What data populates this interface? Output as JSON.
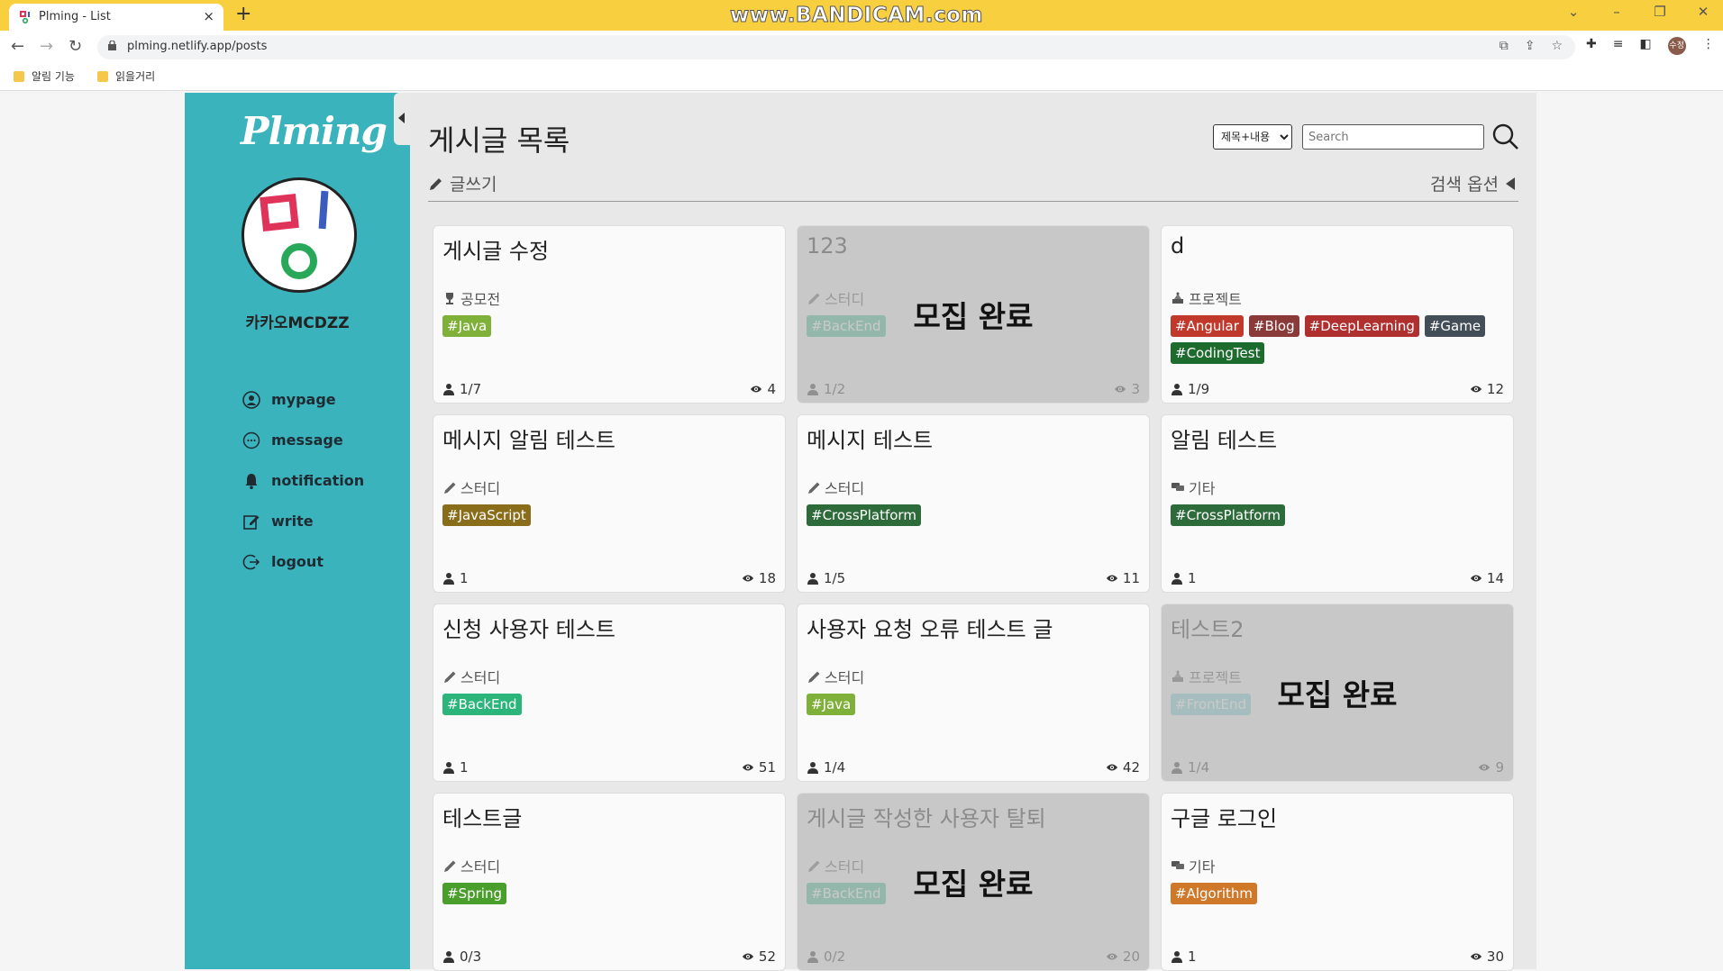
{
  "browser": {
    "tab_title": "Plming - List",
    "tab_close": "×",
    "new_tab": "+",
    "watermark": "www.BANDICAM.com",
    "url": "plming.netlify.app/posts",
    "profile_initials": "수정",
    "bookmarks": [
      "알림 기능",
      "읽을거리"
    ]
  },
  "sidebar": {
    "logo": "Plming",
    "username": "카카오MCDZZ",
    "menu": [
      {
        "label": "mypage",
        "icon": "user-circle-icon"
      },
      {
        "label": "message",
        "icon": "message-icon"
      },
      {
        "label": "notification",
        "icon": "bell-icon"
      },
      {
        "label": "write",
        "icon": "edit-icon"
      },
      {
        "label": "logout",
        "icon": "logout-icon"
      }
    ]
  },
  "main": {
    "title": "게시글 목록",
    "search_select": "제목+내용",
    "search_placeholder": "Search",
    "write_label": "글쓰기",
    "search_options_label": "검색 옵션"
  },
  "colors": {
    "sidebar": "#3bb3bd",
    "browser_bar": "#f7cf3f"
  },
  "posts": [
    {
      "title": "게시글 수정",
      "category": "공모전",
      "category_icon": "trophy-icon",
      "tags": [
        {
          "text": "#Java",
          "color": "#7fb03a"
        }
      ],
      "members": "1/7",
      "views": "4",
      "done": false
    },
    {
      "title": "123",
      "category": "스터디",
      "category_icon": "pencil-icon",
      "tags": [
        {
          "text": "#BackEnd",
          "color": "#3fbf8f"
        }
      ],
      "members": "1/2",
      "views": "3",
      "done": true
    },
    {
      "title": "d",
      "category": "프로젝트",
      "category_icon": "project-icon",
      "tags": [
        {
          "text": "#Angular",
          "color": "#c0392b"
        },
        {
          "text": "#Blog",
          "color": "#8b3a3a"
        },
        {
          "text": "#DeepLearning",
          "color": "#b03030"
        },
        {
          "text": "#Game",
          "color": "#444e58"
        },
        {
          "text": "#CodingTest",
          "color": "#1e6b2e"
        }
      ],
      "members": "1/9",
      "views": "12",
      "done": false
    },
    {
      "title": "메시지 알림 테스트",
      "category": "스터디",
      "category_icon": "pencil-icon",
      "tags": [
        {
          "text": "#JavaScript",
          "color": "#8a6d1a"
        }
      ],
      "members": "1",
      "views": "18",
      "done": false
    },
    {
      "title": "메시지 테스트",
      "category": "스터디",
      "category_icon": "pencil-icon",
      "tags": [
        {
          "text": "#CrossPlatform",
          "color": "#2e6b3a"
        }
      ],
      "members": "1/5",
      "views": "11",
      "done": false
    },
    {
      "title": "알림 테스트",
      "category": "기타",
      "category_icon": "chat-icon",
      "tags": [
        {
          "text": "#CrossPlatform",
          "color": "#2e6b3a"
        }
      ],
      "members": "1",
      "views": "14",
      "done": false
    },
    {
      "title": "신청 사용자 테스트",
      "category": "스터디",
      "category_icon": "pencil-icon",
      "tags": [
        {
          "text": "#BackEnd",
          "color": "#2bb57a"
        }
      ],
      "members": "1",
      "views": "51",
      "done": false
    },
    {
      "title": "사용자 요청 오류 테스트 글",
      "category": "스터디",
      "category_icon": "pencil-icon",
      "tags": [
        {
          "text": "#Java",
          "color": "#7fb03a"
        }
      ],
      "members": "1/4",
      "views": "42",
      "done": false
    },
    {
      "title": "테스트2",
      "category": "프로젝트",
      "category_icon": "project-icon",
      "tags": [
        {
          "text": "#FrontEnd",
          "color": "#7fd3d8"
        }
      ],
      "members": "1/4",
      "views": "9",
      "done": true
    },
    {
      "title": "테스트글",
      "category": "스터디",
      "category_icon": "pencil-icon",
      "tags": [
        {
          "text": "#Spring",
          "color": "#4a9e2c"
        }
      ],
      "members": "0/3",
      "views": "52",
      "done": false
    },
    {
      "title": "게시글 작성한 사용자 탈퇴",
      "category": "스터디",
      "category_icon": "pencil-icon",
      "tags": [
        {
          "text": "#BackEnd",
          "color": "#3fbf8f"
        }
      ],
      "members": "0/2",
      "views": "20",
      "done": true
    },
    {
      "title": "구글 로그인",
      "category": "기타",
      "category_icon": "chat-icon",
      "tags": [
        {
          "text": "#Algorithm",
          "color": "#d0782a"
        }
      ],
      "members": "1",
      "views": "30",
      "done": false
    }
  ],
  "done_label": "모집 완료"
}
